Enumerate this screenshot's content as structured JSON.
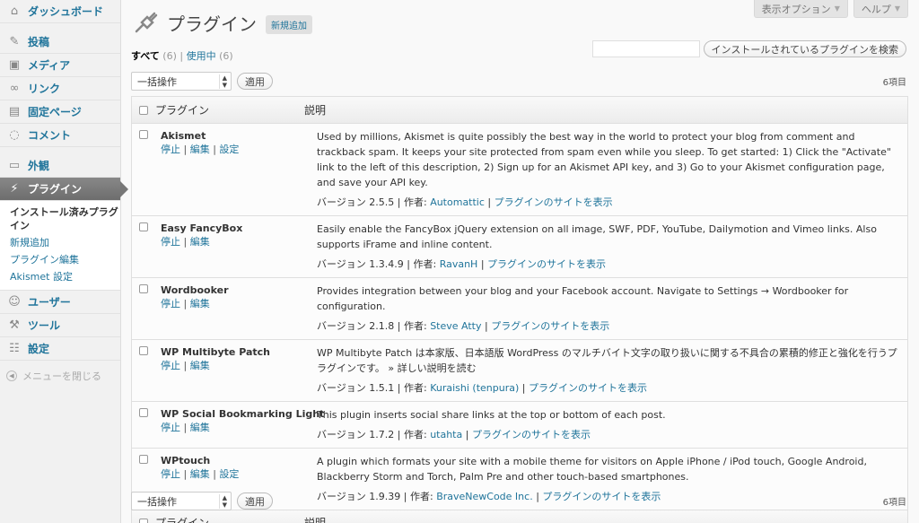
{
  "sidebar": {
    "items": [
      {
        "label": "ダッシュボード",
        "icon": "house"
      },
      {
        "label": "投稿",
        "icon": "pin"
      },
      {
        "label": "メディア",
        "icon": "media"
      },
      {
        "label": "リンク",
        "icon": "link"
      },
      {
        "label": "固定ページ",
        "icon": "page"
      },
      {
        "label": "コメント",
        "icon": "comment"
      },
      {
        "label": "外観",
        "icon": "appearance"
      },
      {
        "label": "プラグイン",
        "icon": "plug"
      },
      {
        "label": "ユーザー",
        "icon": "users"
      },
      {
        "label": "ツール",
        "icon": "tools"
      },
      {
        "label": "設定",
        "icon": "settings"
      }
    ],
    "submenu": [
      "インストール済みプラグイン",
      "新規追加",
      "プラグイン編集",
      "Akismet 設定"
    ],
    "collapse_label": "メニューを閉じる"
  },
  "screen_meta": {
    "options": "表示オプション",
    "help": "ヘルプ"
  },
  "header": {
    "title": "プラグイン",
    "add_new": "新規追加"
  },
  "filters": {
    "all": "すべて",
    "all_count": "(6)",
    "sep": "|",
    "active": "使用中",
    "active_count": "(6)"
  },
  "search": {
    "button": "インストールされているプラグインを検索",
    "value": ""
  },
  "bulk": {
    "select": "一括操作",
    "apply": "適用",
    "count": "6項目"
  },
  "table": {
    "col_name": "プラグイン",
    "col_desc": "説明",
    "rows": [
      {
        "name": "Akismet",
        "actions": [
          "停止",
          "編集",
          "設定"
        ],
        "description": "Used by millions, Akismet is quite possibly the best way in the world to protect your blog from comment and trackback spam. It keeps your site protected from spam even while you sleep. To get started: 1) Click the \"Activate\" link to the left of this description, 2) Sign up for an Akismet API key, and 3) Go to your Akismet configuration page, and save your API key.",
        "version": "バージョン 2.5.5",
        "author_label": "作者:",
        "author": "Automattic",
        "site": "プラグインのサイトを表示"
      },
      {
        "name": "Easy FancyBox",
        "actions": [
          "停止",
          "編集"
        ],
        "description": "Easily enable the FancyBox jQuery extension on all image, SWF, PDF, YouTube, Dailymotion and Vimeo links. Also supports iFrame and inline content.",
        "version": "バージョン 1.3.4.9",
        "author_label": "作者:",
        "author": "RavanH",
        "site": "プラグインのサイトを表示"
      },
      {
        "name": "Wordbooker",
        "actions": [
          "停止",
          "編集"
        ],
        "description": "Provides integration between your blog and your Facebook account. Navigate to Settings → Wordbooker for configuration.",
        "version": "バージョン 2.1.8",
        "author_label": "作者:",
        "author": "Steve Atty",
        "site": "プラグインのサイトを表示"
      },
      {
        "name": "WP Multibyte Patch",
        "actions": [
          "停止",
          "編集"
        ],
        "description": "WP Multibyte Patch は本家版、日本語版 WordPress のマルチバイト文字の取り扱いに関する不具合の累積的修正と強化を行うプラグインです。 » 詳しい説明を読む",
        "version": "バージョン 1.5.1",
        "author_label": "作者:",
        "author": "Kuraishi (tenpura)",
        "site": "プラグインのサイトを表示"
      },
      {
        "name": "WP Social Bookmarking Light",
        "actions": [
          "停止",
          "編集"
        ],
        "description": "This plugin inserts social share links at the top or bottom of each post.",
        "version": "バージョン 1.7.2",
        "author_label": "作者:",
        "author": "utahta",
        "site": "プラグインのサイトを表示"
      },
      {
        "name": "WPtouch",
        "actions": [
          "停止",
          "編集",
          "設定"
        ],
        "description": "A plugin which formats your site with a mobile theme for visitors on Apple iPhone / iPod touch, Google Android, Blackberry Storm and Torch, Palm Pre and other touch-based smartphones.",
        "version": "バージョン 1.9.39",
        "author_label": "作者:",
        "author": "BraveNewCode Inc.",
        "site": "プラグインのサイトを表示"
      }
    ]
  }
}
